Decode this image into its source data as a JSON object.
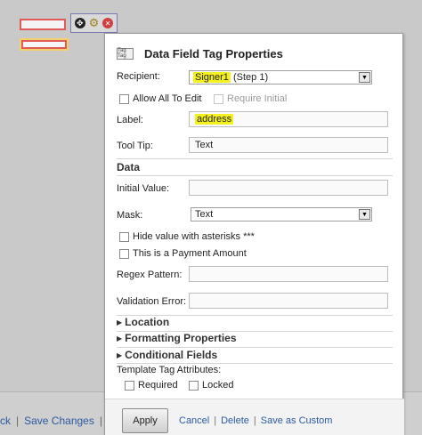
{
  "dialog": {
    "title": "Data Field Tag Properties",
    "tag_icon_text": "Tag Tag",
    "recipient_label": "Recipient:",
    "recipient_value_highlight": "Signer1",
    "recipient_value_rest": " (Step 1)",
    "allow_all_to_edit": "Allow All To Edit",
    "require_initial": "Require Initial",
    "label_label": "Label:",
    "label_value": "address",
    "tooltip_label": "Tool Tip:",
    "tooltip_value": "Text",
    "data_section": "Data",
    "initial_value_label": "Initial Value:",
    "initial_value": "",
    "mask_label": "Mask:",
    "mask_value": "Text",
    "hide_value_label": "Hide value with asterisks ***",
    "payment_label": "This is a Payment Amount",
    "regex_label": "Regex Pattern:",
    "regex_value": "",
    "validation_label": "Validation Error:",
    "validation_value": "",
    "location": "Location",
    "formatting": "Formatting Properties",
    "conditional": "Conditional Fields",
    "template_attrs": "Template Tag Attributes:",
    "required": "Required",
    "locked": "Locked",
    "apply": "Apply",
    "cancel": "Cancel",
    "delete": "Delete",
    "save_as_custom": "Save as Custom"
  },
  "background": {
    "back_fragment": "ck",
    "save_changes": "Save Changes"
  },
  "colors": {
    "highlight": "#f5f020",
    "link": "#2a5aa0"
  }
}
